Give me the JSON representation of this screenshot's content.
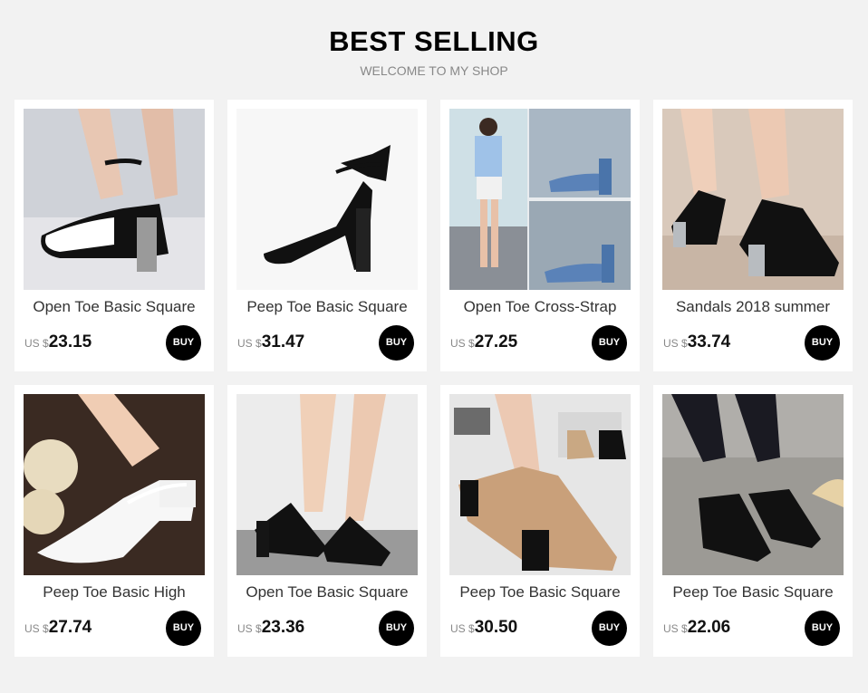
{
  "header": {
    "title": "BEST SELLING",
    "subtitle": "WELCOME TO MY SHOP"
  },
  "products": [
    {
      "name": "Open Toe Basic Square",
      "currency": "US $",
      "price": "23.15",
      "buy_label": "BUY"
    },
    {
      "name": "Peep Toe Basic Square",
      "currency": "US $",
      "price": "31.47",
      "buy_label": "BUY"
    },
    {
      "name": "Open Toe Cross-Strap",
      "currency": "US $",
      "price": "27.25",
      "buy_label": "BUY"
    },
    {
      "name": "Sandals 2018 summer",
      "currency": "US $",
      "price": "33.74",
      "buy_label": "BUY"
    },
    {
      "name": "Peep Toe Basic High",
      "currency": "US $",
      "price": "27.74",
      "buy_label": "BUY"
    },
    {
      "name": "Open Toe Basic Square",
      "currency": "US $",
      "price": "23.36",
      "buy_label": "BUY"
    },
    {
      "name": "Peep Toe Basic Square",
      "currency": "US $",
      "price": "30.50",
      "buy_label": "BUY"
    },
    {
      "name": "Peep Toe Basic Square",
      "currency": "US $",
      "price": "22.06",
      "buy_label": "BUY"
    }
  ]
}
